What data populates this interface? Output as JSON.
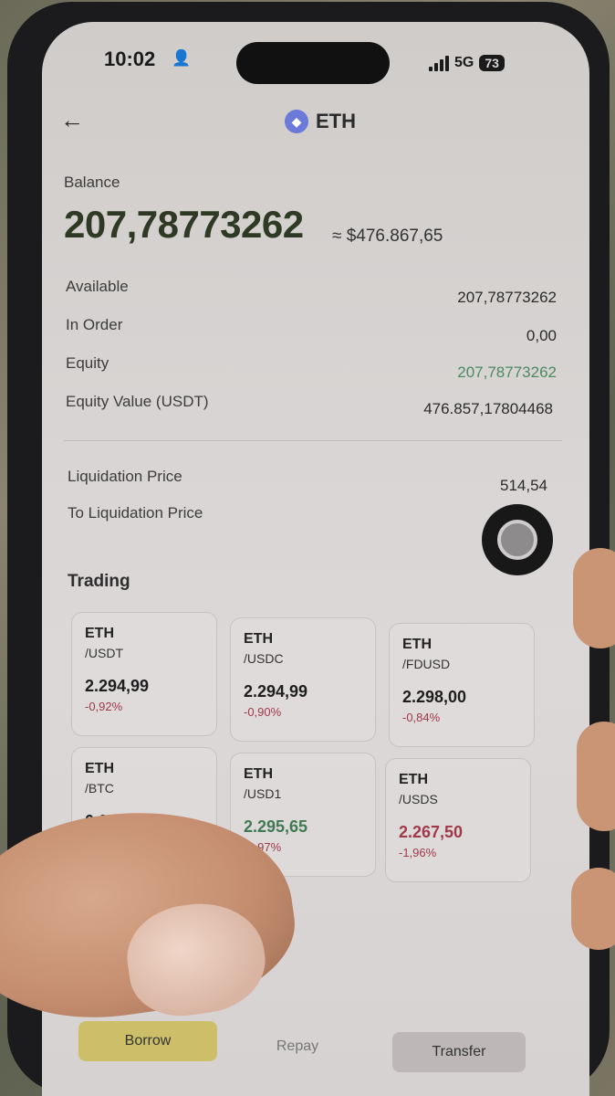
{
  "status": {
    "time": "10:02",
    "network": "5G",
    "battery": "73"
  },
  "header": {
    "title": "ETH"
  },
  "balance": {
    "label": "Balance",
    "amount": "207,78773262",
    "usd": "≈ $476.867,65"
  },
  "rows": {
    "available": {
      "label": "Available",
      "value": "207,78773262"
    },
    "in_order": {
      "label": "In Order",
      "value": "0,00"
    },
    "equity": {
      "label": "Equity",
      "value": "207,78773262"
    },
    "equity_value": {
      "label": "Equity Value (USDT)",
      "value": "476.857,17804468"
    },
    "liq_price": {
      "label": "Liquidation Price",
      "value": "514,54"
    },
    "to_liq": {
      "label": "To Liquidation Price"
    }
  },
  "trading": {
    "title": "Trading",
    "pairs": [
      {
        "base": "ETH",
        "quote": "/USDT",
        "price": "2.294,99",
        "change": "-0,92%"
      },
      {
        "base": "ETH",
        "quote": "/USDC",
        "price": "2.294,99",
        "change": "-0,90%"
      },
      {
        "base": "ETH",
        "quote": "/FDUSD",
        "price": "2.298,00",
        "change": "-0,84%"
      },
      {
        "base": "ETH",
        "quote": "/BTC",
        "price": "0,02831",
        "change": ""
      },
      {
        "base": "ETH",
        "quote": "/USD1",
        "price": "2.295,65",
        "change": "-0,97%"
      },
      {
        "base": "ETH",
        "quote": "/USDS",
        "price": "2.267,50",
        "change": "-1,96%"
      }
    ]
  },
  "actions": {
    "borrow": "Borrow",
    "repay": "Repay",
    "transfer": "Transfer"
  },
  "colors": {
    "up": "#3f7a55",
    "down": "#a0394a",
    "equity": "#4b8a62"
  }
}
